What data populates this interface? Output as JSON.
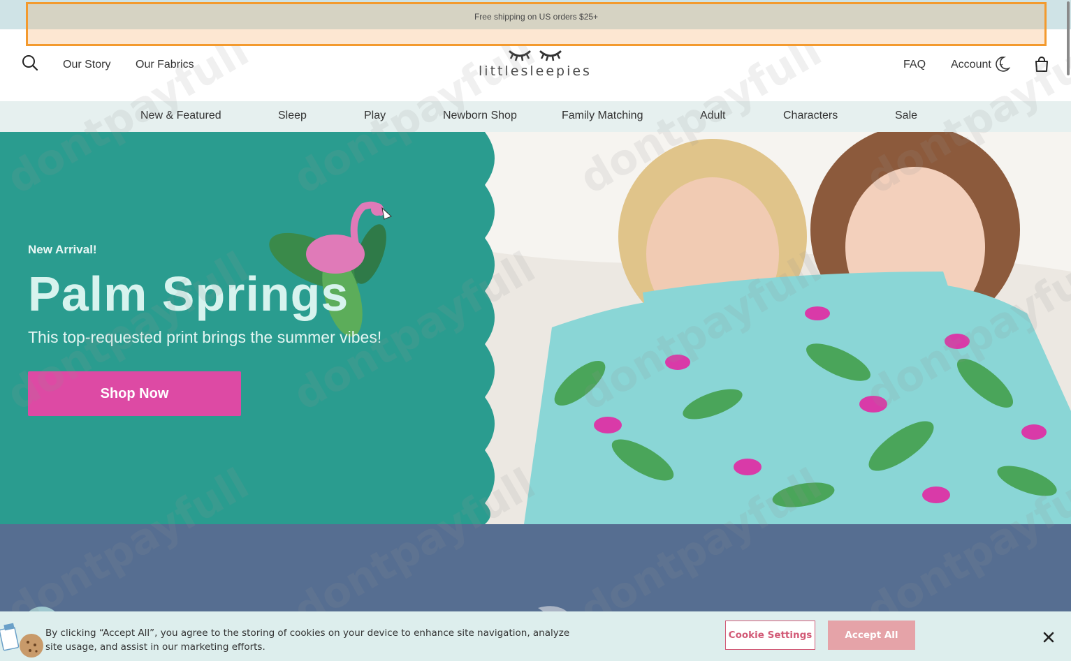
{
  "announcement": {
    "text": "Free shipping on US orders $25+"
  },
  "header": {
    "left_links": [
      "Our Story",
      "Our Fabrics"
    ],
    "logo_text": "littlesleepies",
    "right_links": {
      "faq": "FAQ",
      "account": "Account"
    }
  },
  "nav": {
    "items": [
      "New & Featured",
      "Sleep",
      "Play",
      "Newborn Shop",
      "Family Matching",
      "Adult",
      "Characters",
      "Sale"
    ]
  },
  "hero": {
    "eyebrow": "New Arrival!",
    "title": "Palm Springs",
    "subtitle": "This top-requested print brings the summer vibes!",
    "cta": "Shop Now"
  },
  "cookie_banner": {
    "text": "By clicking “Accept All”, you agree to the storing of cookies on your device to enhance site navigation, analyze site usage, and assist in our marketing efforts.",
    "settings_label": "Cookie Settings",
    "accept_label": "Accept All"
  },
  "watermark": "dontpayfull",
  "colors": {
    "hero_teal": "#2a9c8f",
    "cta_pink": "#dd4aa4",
    "nav_bg": "#e6f0ef",
    "lower_band": "#566e91",
    "highlight_orange": "#f39a2e"
  },
  "icons": [
    "search-icon",
    "moon-icon",
    "bag-icon",
    "close-icon"
  ]
}
